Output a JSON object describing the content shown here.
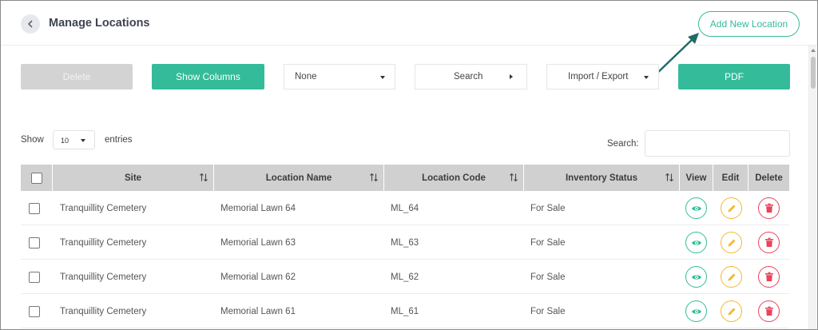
{
  "header": {
    "title": "Manage Locations",
    "add_button": "Add New Location"
  },
  "toolbar": {
    "delete_label": "Delete",
    "show_columns_label": "Show Columns",
    "filter_value": "None",
    "search_button_label": "Search",
    "import_export_label": "Import / Export",
    "pdf_label": "PDF"
  },
  "entries": {
    "show_label": "Show",
    "value": "10",
    "suffix_label": "entries"
  },
  "search": {
    "label": "Search:",
    "value": ""
  },
  "table": {
    "columns": [
      "Site",
      "Location Name",
      "Location Code",
      "Inventory Status",
      "View",
      "Edit",
      "Delete"
    ],
    "rows": [
      {
        "site": "Tranquillity Cemetery",
        "location_name": "Memorial Lawn 64",
        "location_code": "ML_64",
        "inventory_status": "For Sale"
      },
      {
        "site": "Tranquillity Cemetery",
        "location_name": "Memorial Lawn 63",
        "location_code": "ML_63",
        "inventory_status": "For Sale"
      },
      {
        "site": "Tranquillity Cemetery",
        "location_name": "Memorial Lawn 62",
        "location_code": "ML_62",
        "inventory_status": "For Sale"
      },
      {
        "site": "Tranquillity Cemetery",
        "location_name": "Memorial Lawn 61",
        "location_code": "ML_61",
        "inventory_status": "For Sale"
      }
    ]
  },
  "icons": {
    "back": "chevron-left-icon",
    "sort": "sort-arrows-icon",
    "view": "eye-icon",
    "edit": "pencil-icon",
    "delete": "trash-icon"
  },
  "colors": {
    "accent": "#34bb9a",
    "edit": "#f5b72e",
    "delete": "#e8455b",
    "disabled": "#d3d3d3",
    "header_bg": "#d0d0d0",
    "arrow": "#1f6b66"
  }
}
